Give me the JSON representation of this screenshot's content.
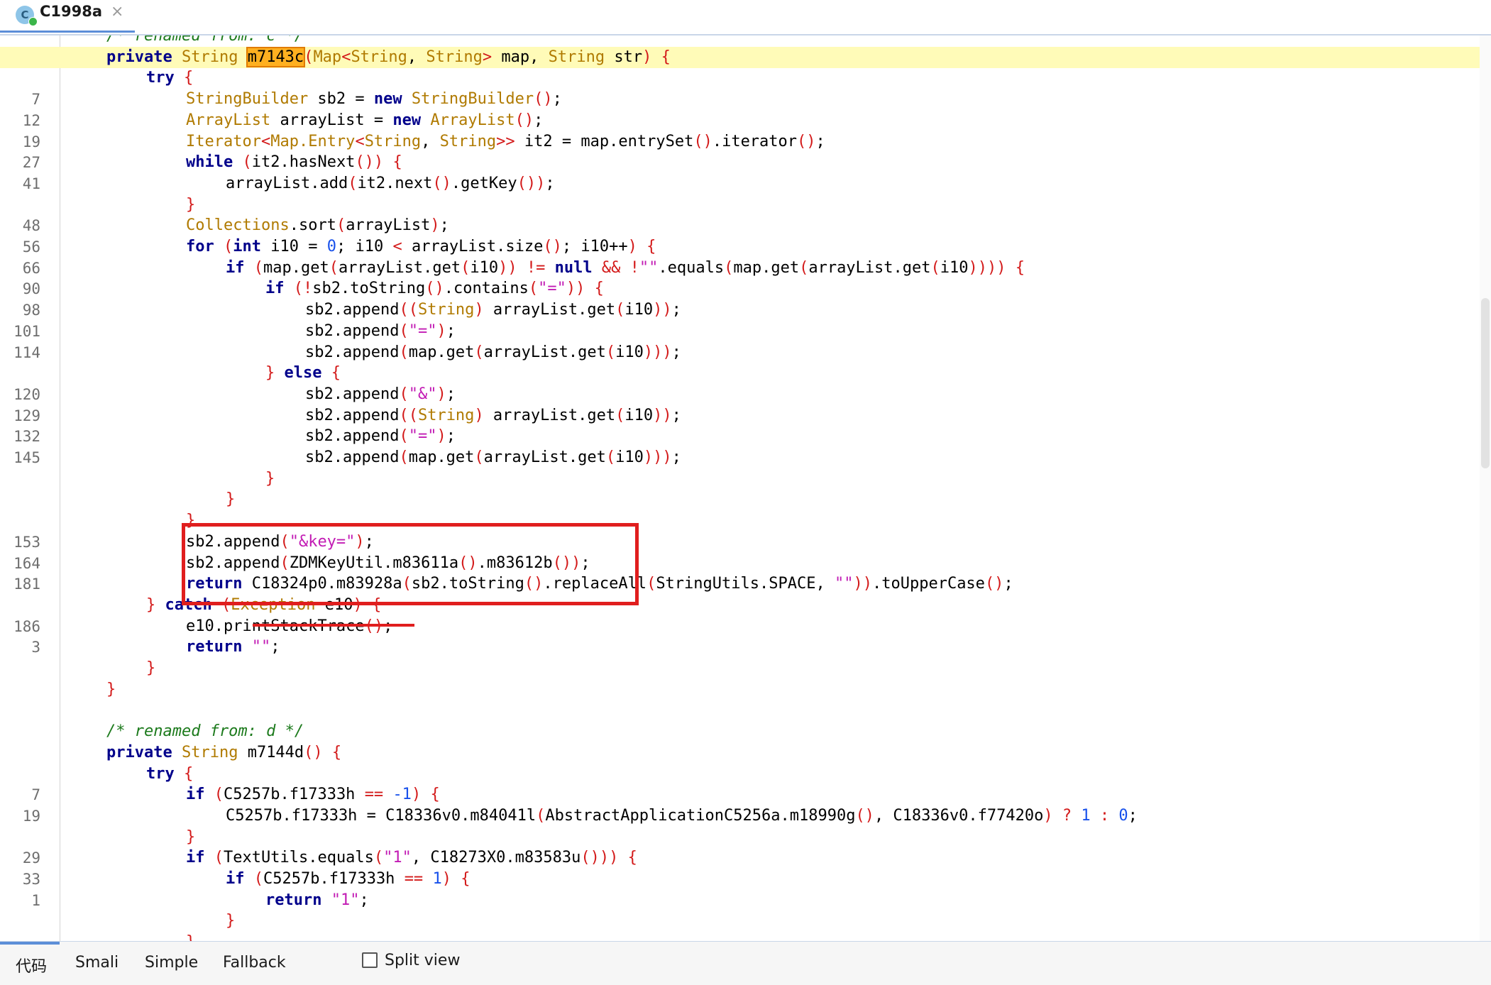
{
  "tab": {
    "title": "C1998a",
    "close": "×",
    "icon": "class-c-icon",
    "icon_letter": "C"
  },
  "bottom_tabs": {
    "code": "代码",
    "smali": "Smali",
    "simple": "Simple",
    "fallback": "Fallback",
    "split_view": "Split view"
  },
  "colors": {
    "annotation": "#e01e1e",
    "highlight_line": "#fffbb8",
    "selection": "#ffb020"
  },
  "code_lines": [
    {
      "n": "",
      "hl": false,
      "indent": 0,
      "t": [
        [
          "cmt",
          "/* renamed from: c */"
        ]
      ]
    },
    {
      "n": "",
      "hl": true,
      "indent": 0,
      "t": [
        [
          "kw",
          "private"
        ],
        [
          "pl",
          " "
        ],
        [
          "ty",
          "String"
        ],
        [
          "pl",
          " "
        ],
        [
          "sel",
          "m7143c"
        ],
        [
          "pn",
          "("
        ],
        [
          "ty",
          "Map"
        ],
        [
          "pn",
          "<"
        ],
        [
          "ty",
          "String"
        ],
        [
          "pl",
          ", "
        ],
        [
          "ty",
          "String"
        ],
        [
          "pn",
          ">"
        ],
        [
          "pl",
          " map, "
        ],
        [
          "ty",
          "String"
        ],
        [
          "pl",
          " str"
        ],
        [
          "pn",
          ")"
        ],
        [
          "pl",
          " "
        ],
        [
          "pn",
          "{"
        ]
      ]
    },
    {
      "n": "",
      "hl": false,
      "indent": 1,
      "t": [
        [
          "kw",
          "try"
        ],
        [
          "pl",
          " "
        ],
        [
          "pn",
          "{"
        ]
      ]
    },
    {
      "n": "7",
      "hl": false,
      "indent": 2,
      "t": [
        [
          "ty",
          "StringBuilder"
        ],
        [
          "pl",
          " sb2 = "
        ],
        [
          "kw",
          "new"
        ],
        [
          "pl",
          " "
        ],
        [
          "ty",
          "StringBuilder"
        ],
        [
          "pn",
          "()"
        ],
        [
          "pl",
          ";"
        ]
      ]
    },
    {
      "n": "12",
      "hl": false,
      "indent": 2,
      "t": [
        [
          "ty",
          "ArrayList"
        ],
        [
          "pl",
          " arrayList = "
        ],
        [
          "kw",
          "new"
        ],
        [
          "pl",
          " "
        ],
        [
          "ty",
          "ArrayList"
        ],
        [
          "pn",
          "()"
        ],
        [
          "pl",
          ";"
        ]
      ]
    },
    {
      "n": "19",
      "hl": false,
      "indent": 2,
      "t": [
        [
          "ty",
          "Iterator"
        ],
        [
          "pn",
          "<"
        ],
        [
          "ty",
          "Map.Entry"
        ],
        [
          "pn",
          "<"
        ],
        [
          "ty",
          "String"
        ],
        [
          "pl",
          ", "
        ],
        [
          "ty",
          "String"
        ],
        [
          "pn",
          ">>"
        ],
        [
          "pl",
          " it2 = map.entrySet"
        ],
        [
          "pn",
          "()"
        ],
        [
          "pl",
          ".iterator"
        ],
        [
          "pn",
          "()"
        ],
        [
          "pl",
          ";"
        ]
      ]
    },
    {
      "n": "27",
      "hl": false,
      "indent": 2,
      "t": [
        [
          "kw",
          "while"
        ],
        [
          "pl",
          " "
        ],
        [
          "pn",
          "("
        ],
        [
          "pl",
          "it2.hasNext"
        ],
        [
          "pn",
          "())"
        ],
        [
          "pl",
          " "
        ],
        [
          "pn",
          "{"
        ]
      ]
    },
    {
      "n": "41",
      "hl": false,
      "indent": 3,
      "t": [
        [
          "pl",
          "arrayList.add"
        ],
        [
          "pn",
          "("
        ],
        [
          "pl",
          "it2.next"
        ],
        [
          "pn",
          "()"
        ],
        [
          "pl",
          ".getKey"
        ],
        [
          "pn",
          "())"
        ],
        [
          "pl",
          ";"
        ]
      ]
    },
    {
      "n": "",
      "hl": false,
      "indent": 2,
      "t": [
        [
          "pn",
          "}"
        ]
      ]
    },
    {
      "n": "48",
      "hl": false,
      "indent": 2,
      "t": [
        [
          "ty",
          "Collections"
        ],
        [
          "pl",
          ".sort"
        ],
        [
          "pn",
          "("
        ],
        [
          "pl",
          "arrayList"
        ],
        [
          "pn",
          ")"
        ],
        [
          "pl",
          ";"
        ]
      ]
    },
    {
      "n": "56",
      "hl": false,
      "indent": 2,
      "t": [
        [
          "kw",
          "for"
        ],
        [
          "pl",
          " "
        ],
        [
          "pn",
          "("
        ],
        [
          "kw",
          "int"
        ],
        [
          "pl",
          " i10 = "
        ],
        [
          "num",
          "0"
        ],
        [
          "pl",
          "; i10 "
        ],
        [
          "pn",
          "<"
        ],
        [
          "pl",
          " arrayList.size"
        ],
        [
          "pn",
          "()"
        ],
        [
          "pl",
          "; i10++"
        ],
        [
          "pn",
          ")"
        ],
        [
          "pl",
          " "
        ],
        [
          "pn",
          "{"
        ]
      ]
    },
    {
      "n": "66",
      "hl": false,
      "indent": 3,
      "t": [
        [
          "kw",
          "if"
        ],
        [
          "pl",
          " "
        ],
        [
          "pn",
          "("
        ],
        [
          "pl",
          "map.get"
        ],
        [
          "pn",
          "("
        ],
        [
          "pl",
          "arrayList.get"
        ],
        [
          "pn",
          "("
        ],
        [
          "pl",
          "i10"
        ],
        [
          "pn",
          "))"
        ],
        [
          "pl",
          " "
        ],
        [
          "pn",
          "!="
        ],
        [
          "pl",
          " "
        ],
        [
          "kw",
          "null"
        ],
        [
          "pl",
          " "
        ],
        [
          "pn",
          "&&"
        ],
        [
          "pl",
          " "
        ],
        [
          "pn",
          "!"
        ],
        [
          "str",
          "\"\""
        ],
        [
          "pl",
          ".equals"
        ],
        [
          "pn",
          "("
        ],
        [
          "pl",
          "map.get"
        ],
        [
          "pn",
          "("
        ],
        [
          "pl",
          "arrayList.get"
        ],
        [
          "pn",
          "("
        ],
        [
          "pl",
          "i10"
        ],
        [
          "pn",
          "))))"
        ],
        [
          "pl",
          " "
        ],
        [
          "pn",
          "{"
        ]
      ]
    },
    {
      "n": "90",
      "hl": false,
      "indent": 4,
      "t": [
        [
          "kw",
          "if"
        ],
        [
          "pl",
          " "
        ],
        [
          "pn",
          "(!"
        ],
        [
          "pl",
          "sb2.toString"
        ],
        [
          "pn",
          "()"
        ],
        [
          "pl",
          ".contains"
        ],
        [
          "pn",
          "("
        ],
        [
          "str",
          "\"=\""
        ],
        [
          "pn",
          "))"
        ],
        [
          "pl",
          " "
        ],
        [
          "pn",
          "{"
        ]
      ]
    },
    {
      "n": "98",
      "hl": false,
      "indent": 5,
      "t": [
        [
          "pl",
          "sb2.append"
        ],
        [
          "pn",
          "(("
        ],
        [
          "ty",
          "String"
        ],
        [
          "pn",
          ")"
        ],
        [
          "pl",
          " arrayList.get"
        ],
        [
          "pn",
          "("
        ],
        [
          "pl",
          "i10"
        ],
        [
          "pn",
          "))"
        ],
        [
          "pl",
          ";"
        ]
      ]
    },
    {
      "n": "101",
      "hl": false,
      "indent": 5,
      "t": [
        [
          "pl",
          "sb2.append"
        ],
        [
          "pn",
          "("
        ],
        [
          "str",
          "\"=\""
        ],
        [
          "pn",
          ")"
        ],
        [
          "pl",
          ";"
        ]
      ]
    },
    {
      "n": "114",
      "hl": false,
      "indent": 5,
      "t": [
        [
          "pl",
          "sb2.append"
        ],
        [
          "pn",
          "("
        ],
        [
          "pl",
          "map.get"
        ],
        [
          "pn",
          "("
        ],
        [
          "pl",
          "arrayList.get"
        ],
        [
          "pn",
          "("
        ],
        [
          "pl",
          "i10"
        ],
        [
          "pn",
          ")))"
        ],
        [
          "pl",
          ";"
        ]
      ]
    },
    {
      "n": "",
      "hl": false,
      "indent": 4,
      "t": [
        [
          "pn",
          "}"
        ],
        [
          "pl",
          " "
        ],
        [
          "kw",
          "else"
        ],
        [
          "pl",
          " "
        ],
        [
          "pn",
          "{"
        ]
      ]
    },
    {
      "n": "120",
      "hl": false,
      "indent": 5,
      "t": [
        [
          "pl",
          "sb2.append"
        ],
        [
          "pn",
          "("
        ],
        [
          "str",
          "\"&\""
        ],
        [
          "pn",
          ")"
        ],
        [
          "pl",
          ";"
        ]
      ]
    },
    {
      "n": "129",
      "hl": false,
      "indent": 5,
      "t": [
        [
          "pl",
          "sb2.append"
        ],
        [
          "pn",
          "(("
        ],
        [
          "ty",
          "String"
        ],
        [
          "pn",
          ")"
        ],
        [
          "pl",
          " arrayList.get"
        ],
        [
          "pn",
          "("
        ],
        [
          "pl",
          "i10"
        ],
        [
          "pn",
          "))"
        ],
        [
          "pl",
          ";"
        ]
      ]
    },
    {
      "n": "132",
      "hl": false,
      "indent": 5,
      "t": [
        [
          "pl",
          "sb2.append"
        ],
        [
          "pn",
          "("
        ],
        [
          "str",
          "\"=\""
        ],
        [
          "pn",
          ")"
        ],
        [
          "pl",
          ";"
        ]
      ]
    },
    {
      "n": "145",
      "hl": false,
      "indent": 5,
      "t": [
        [
          "pl",
          "sb2.append"
        ],
        [
          "pn",
          "("
        ],
        [
          "pl",
          "map.get"
        ],
        [
          "pn",
          "("
        ],
        [
          "pl",
          "arrayList.get"
        ],
        [
          "pn",
          "("
        ],
        [
          "pl",
          "i10"
        ],
        [
          "pn",
          ")))"
        ],
        [
          "pl",
          ";"
        ]
      ]
    },
    {
      "n": "",
      "hl": false,
      "indent": 4,
      "t": [
        [
          "pn",
          "}"
        ]
      ]
    },
    {
      "n": "",
      "hl": false,
      "indent": 3,
      "t": [
        [
          "pn",
          "}"
        ]
      ]
    },
    {
      "n": "",
      "hl": false,
      "indent": 2,
      "t": [
        [
          "pn",
          "}"
        ]
      ]
    },
    {
      "n": "153",
      "hl": false,
      "indent": 2,
      "t": [
        [
          "pl",
          "sb2.append"
        ],
        [
          "pn",
          "("
        ],
        [
          "str",
          "\"&key=\""
        ],
        [
          "pn",
          ")"
        ],
        [
          "pl",
          ";"
        ]
      ]
    },
    {
      "n": "164",
      "hl": false,
      "indent": 2,
      "t": [
        [
          "pl",
          "sb2.append"
        ],
        [
          "pn",
          "("
        ],
        [
          "pl",
          "ZDMKeyUtil.m83611a"
        ],
        [
          "pn",
          "()"
        ],
        [
          "pl",
          ".m83612b"
        ],
        [
          "pn",
          "())"
        ],
        [
          "pl",
          ";"
        ]
      ]
    },
    {
      "n": "181",
      "hl": false,
      "indent": 2,
      "t": [
        [
          "kw",
          "return"
        ],
        [
          "pl",
          " C18324p0.m83928a"
        ],
        [
          "pn",
          "("
        ],
        [
          "pl",
          "sb2.toString"
        ],
        [
          "pn",
          "()"
        ],
        [
          "pl",
          ".replaceAll"
        ],
        [
          "pn",
          "("
        ],
        [
          "pl",
          "StringUtils.SPACE, "
        ],
        [
          "str",
          "\"\""
        ],
        [
          "pn",
          "))"
        ],
        [
          "pl",
          ".toUpperCase"
        ],
        [
          "pn",
          "()"
        ],
        [
          "pl",
          ";"
        ]
      ]
    },
    {
      "n": "",
      "hl": false,
      "indent": 1,
      "t": [
        [
          "pn",
          "}"
        ],
        [
          "pl",
          " "
        ],
        [
          "kw",
          "catch"
        ],
        [
          "pl",
          " "
        ],
        [
          "pn",
          "("
        ],
        [
          "ty",
          "Exception"
        ],
        [
          "pl",
          " e10"
        ],
        [
          "pn",
          ")"
        ],
        [
          "pl",
          " "
        ],
        [
          "pn",
          "{"
        ]
      ]
    },
    {
      "n": "186",
      "hl": false,
      "indent": 2,
      "t": [
        [
          "pl",
          "e10.printStackTrace"
        ],
        [
          "pn",
          "()"
        ],
        [
          "pl",
          ";"
        ]
      ]
    },
    {
      "n": "3",
      "hl": false,
      "indent": 2,
      "t": [
        [
          "kw",
          "return"
        ],
        [
          "pl",
          " "
        ],
        [
          "str",
          "\"\""
        ],
        [
          "pl",
          ";"
        ]
      ]
    },
    {
      "n": "",
      "hl": false,
      "indent": 1,
      "t": [
        [
          "pn",
          "}"
        ]
      ]
    },
    {
      "n": "",
      "hl": false,
      "indent": 0,
      "t": [
        [
          "pn",
          "}"
        ]
      ]
    },
    {
      "n": "",
      "hl": false,
      "indent": 0,
      "t": []
    },
    {
      "n": "",
      "hl": false,
      "indent": 0,
      "t": [
        [
          "cmt",
          "/* renamed from: d */"
        ]
      ]
    },
    {
      "n": "",
      "hl": false,
      "indent": 0,
      "t": [
        [
          "kw",
          "private"
        ],
        [
          "pl",
          " "
        ],
        [
          "ty",
          "String"
        ],
        [
          "pl",
          " m7144d"
        ],
        [
          "pn",
          "()"
        ],
        [
          "pl",
          " "
        ],
        [
          "pn",
          "{"
        ]
      ]
    },
    {
      "n": "",
      "hl": false,
      "indent": 1,
      "t": [
        [
          "kw",
          "try"
        ],
        [
          "pl",
          " "
        ],
        [
          "pn",
          "{"
        ]
      ]
    },
    {
      "n": "7",
      "hl": false,
      "indent": 2,
      "t": [
        [
          "kw",
          "if"
        ],
        [
          "pl",
          " "
        ],
        [
          "pn",
          "("
        ],
        [
          "pl",
          "C5257b.f17333h "
        ],
        [
          "pn",
          "=="
        ],
        [
          "pl",
          " "
        ],
        [
          "num",
          "-1"
        ],
        [
          "pn",
          ")"
        ],
        [
          "pl",
          " "
        ],
        [
          "pn",
          "{"
        ]
      ]
    },
    {
      "n": "19",
      "hl": false,
      "indent": 3,
      "t": [
        [
          "pl",
          "C5257b.f17333h = C18336v0.m84041l"
        ],
        [
          "pn",
          "("
        ],
        [
          "pl",
          "AbstractApplicationC5256a.m18990g"
        ],
        [
          "pn",
          "()"
        ],
        [
          "pl",
          ", C18336v0.f77420o"
        ],
        [
          "pn",
          ")"
        ],
        [
          "pl",
          " "
        ],
        [
          "pn",
          "?"
        ],
        [
          "pl",
          " "
        ],
        [
          "num",
          "1"
        ],
        [
          "pl",
          " "
        ],
        [
          "pn",
          ":"
        ],
        [
          "pl",
          " "
        ],
        [
          "num",
          "0"
        ],
        [
          "pl",
          ";"
        ]
      ]
    },
    {
      "n": "",
      "hl": false,
      "indent": 2,
      "t": [
        [
          "pn",
          "}"
        ]
      ]
    },
    {
      "n": "29",
      "hl": false,
      "indent": 2,
      "t": [
        [
          "kw",
          "if"
        ],
        [
          "pl",
          " "
        ],
        [
          "pn",
          "("
        ],
        [
          "pl",
          "TextUtils.equals"
        ],
        [
          "pn",
          "("
        ],
        [
          "str",
          "\"1\""
        ],
        [
          "pl",
          ", C18273X0.m83583u"
        ],
        [
          "pn",
          "()))"
        ],
        [
          "pl",
          " "
        ],
        [
          "pn",
          "{"
        ]
      ]
    },
    {
      "n": "33",
      "hl": false,
      "indent": 3,
      "t": [
        [
          "kw",
          "if"
        ],
        [
          "pl",
          " "
        ],
        [
          "pn",
          "("
        ],
        [
          "pl",
          "C5257b.f17333h "
        ],
        [
          "pn",
          "=="
        ],
        [
          "pl",
          " "
        ],
        [
          "num",
          "1"
        ],
        [
          "pn",
          ")"
        ],
        [
          "pl",
          " "
        ],
        [
          "pn",
          "{"
        ]
      ]
    },
    {
      "n": "1",
      "hl": false,
      "indent": 4,
      "t": [
        [
          "kw",
          "return"
        ],
        [
          "pl",
          " "
        ],
        [
          "str",
          "\"1\""
        ],
        [
          "pl",
          ";"
        ]
      ]
    },
    {
      "n": "",
      "hl": false,
      "indent": 3,
      "t": [
        [
          "pn",
          "}"
        ]
      ]
    },
    {
      "n": "",
      "hl": false,
      "indent": 2,
      "t": [
        [
          "pn",
          "}"
        ]
      ]
    }
  ]
}
